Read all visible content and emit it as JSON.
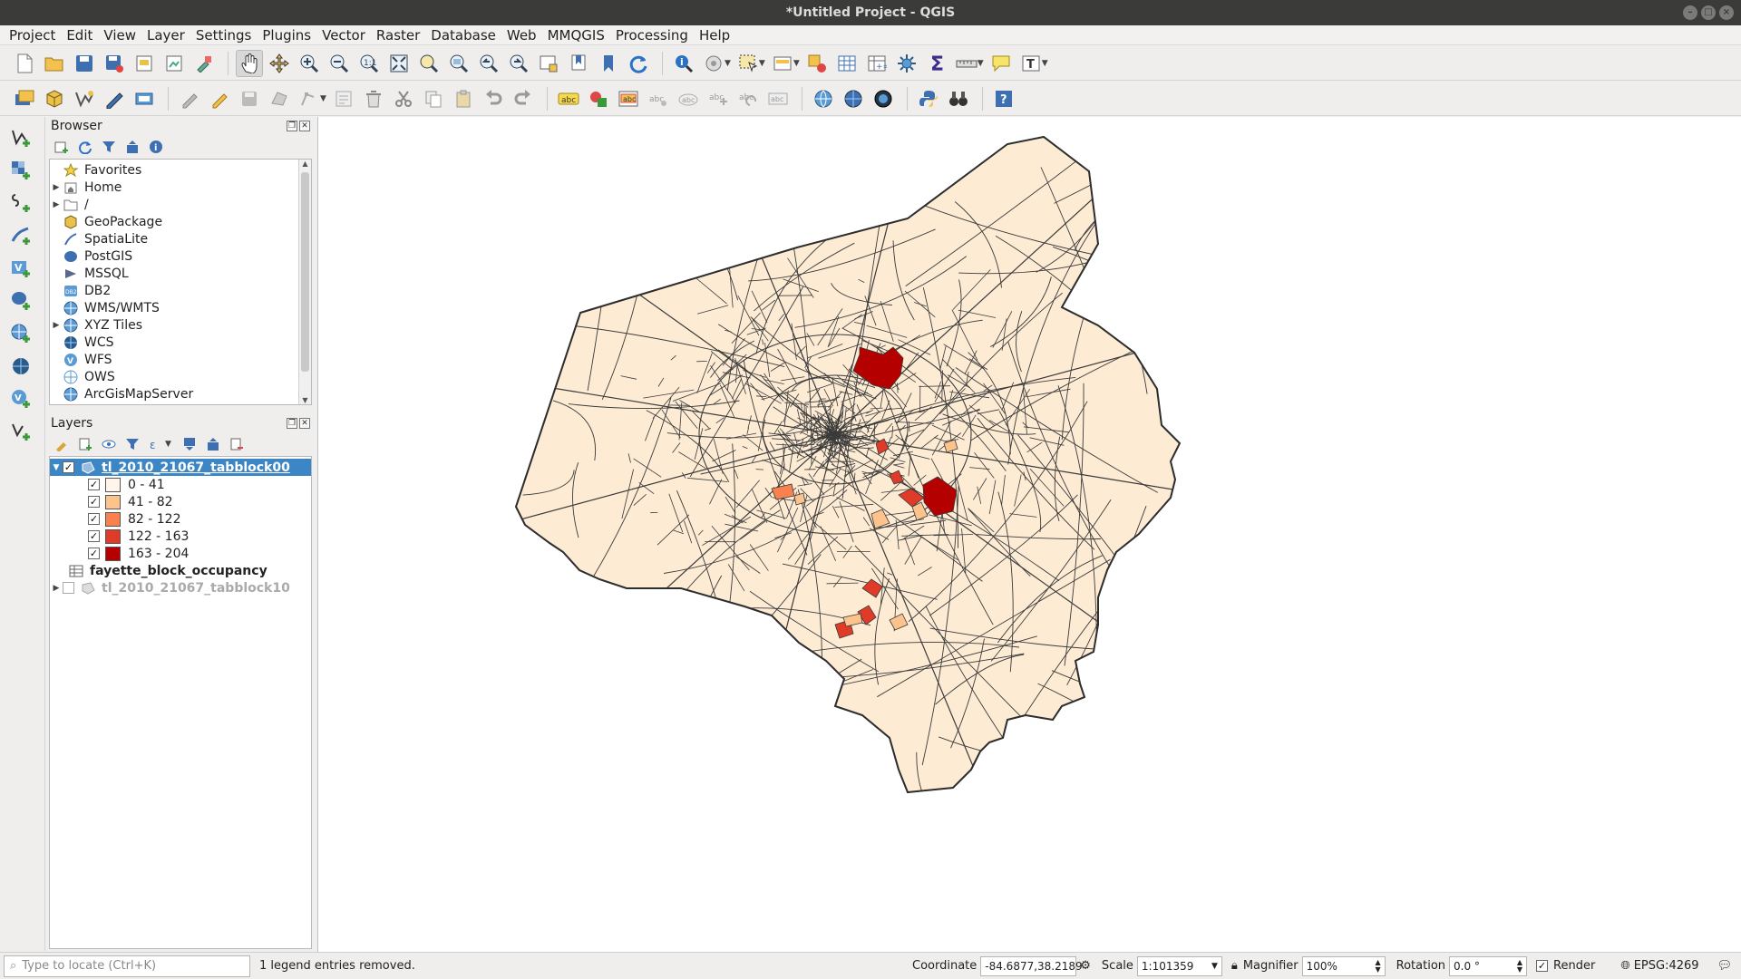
{
  "window": {
    "title": "*Untitled Project - QGIS"
  },
  "menu": {
    "items": [
      {
        "label": "Project"
      },
      {
        "label": "Edit"
      },
      {
        "label": "View"
      },
      {
        "label": "Layer"
      },
      {
        "label": "Settings"
      },
      {
        "label": "Plugins"
      },
      {
        "label": "Vector"
      },
      {
        "label": "Raster"
      },
      {
        "label": "Database"
      },
      {
        "label": "Web"
      },
      {
        "label": "MMQGIS"
      },
      {
        "label": "Processing"
      },
      {
        "label": "Help"
      }
    ]
  },
  "browser": {
    "title": "Browser",
    "items": [
      {
        "label": "Favorites",
        "icon": "star-icon"
      },
      {
        "label": "Home",
        "icon": "home-folder-icon"
      },
      {
        "label": "/",
        "icon": "folder-icon"
      },
      {
        "label": "GeoPackage",
        "icon": "geopackage-icon"
      },
      {
        "label": "SpatiaLite",
        "icon": "spatialite-icon"
      },
      {
        "label": "PostGIS",
        "icon": "postgis-icon"
      },
      {
        "label": "MSSQL",
        "icon": "mssql-icon"
      },
      {
        "label": "DB2",
        "icon": "db2-icon"
      },
      {
        "label": "WMS/WMTS",
        "icon": "globe-icon"
      },
      {
        "label": "XYZ Tiles",
        "icon": "globe-icon"
      },
      {
        "label": "WCS",
        "icon": "globe-icon"
      },
      {
        "label": "WFS",
        "icon": "wfs-icon"
      },
      {
        "label": "OWS",
        "icon": "globe-icon"
      },
      {
        "label": "ArcGisMapServer",
        "icon": "globe-icon"
      }
    ]
  },
  "layers": {
    "title": "Layers",
    "layer1": {
      "name": "tl_2010_21067_tabblock00",
      "checked": true
    },
    "legend": [
      {
        "label": "0 - 41",
        "color": "#fff5eb"
      },
      {
        "label": "41 - 82",
        "color": "#fdc38c"
      },
      {
        "label": "82 - 122",
        "color": "#f9804f"
      },
      {
        "label": "122 - 163",
        "color": "#e03b28"
      },
      {
        "label": "163 - 204",
        "color": "#b50000"
      }
    ],
    "layer2": {
      "name": "fayette_block_occupancy"
    },
    "layer3": {
      "name": "tl_2010_21067_tabblock10",
      "checked": false
    }
  },
  "status": {
    "locator_placeholder": "Type to locate (Ctrl+K)",
    "message": "1 legend entries removed.",
    "coordinate_label": "Coordinate",
    "coordinate_value": "-84.6877,38.2189",
    "scale_label": "Scale",
    "scale_value": "1:101359",
    "magnifier_label": "Magnifier",
    "magnifier_value": "100%",
    "rotation_label": "Rotation",
    "rotation_value": "0.0 °",
    "render_label": "Render",
    "crs": "EPSG:4269"
  },
  "colors": {
    "base_fill": "#fdebd4",
    "outline": "#3a3a3a",
    "selection": "#3d86c6"
  }
}
